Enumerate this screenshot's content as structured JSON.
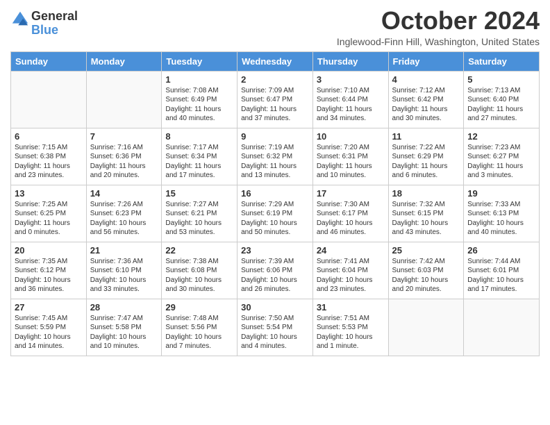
{
  "header": {
    "logo_general": "General",
    "logo_blue": "Blue",
    "title": "October 2024",
    "location": "Inglewood-Finn Hill, Washington, United States"
  },
  "days_of_week": [
    "Sunday",
    "Monday",
    "Tuesday",
    "Wednesday",
    "Thursday",
    "Friday",
    "Saturday"
  ],
  "weeks": [
    [
      {
        "day": "",
        "info": ""
      },
      {
        "day": "",
        "info": ""
      },
      {
        "day": "1",
        "info": "Sunrise: 7:08 AM\nSunset: 6:49 PM\nDaylight: 11 hours and 40 minutes."
      },
      {
        "day": "2",
        "info": "Sunrise: 7:09 AM\nSunset: 6:47 PM\nDaylight: 11 hours and 37 minutes."
      },
      {
        "day": "3",
        "info": "Sunrise: 7:10 AM\nSunset: 6:44 PM\nDaylight: 11 hours and 34 minutes."
      },
      {
        "day": "4",
        "info": "Sunrise: 7:12 AM\nSunset: 6:42 PM\nDaylight: 11 hours and 30 minutes."
      },
      {
        "day": "5",
        "info": "Sunrise: 7:13 AM\nSunset: 6:40 PM\nDaylight: 11 hours and 27 minutes."
      }
    ],
    [
      {
        "day": "6",
        "info": "Sunrise: 7:15 AM\nSunset: 6:38 PM\nDaylight: 11 hours and 23 minutes."
      },
      {
        "day": "7",
        "info": "Sunrise: 7:16 AM\nSunset: 6:36 PM\nDaylight: 11 hours and 20 minutes."
      },
      {
        "day": "8",
        "info": "Sunrise: 7:17 AM\nSunset: 6:34 PM\nDaylight: 11 hours and 17 minutes."
      },
      {
        "day": "9",
        "info": "Sunrise: 7:19 AM\nSunset: 6:32 PM\nDaylight: 11 hours and 13 minutes."
      },
      {
        "day": "10",
        "info": "Sunrise: 7:20 AM\nSunset: 6:31 PM\nDaylight: 11 hours and 10 minutes."
      },
      {
        "day": "11",
        "info": "Sunrise: 7:22 AM\nSunset: 6:29 PM\nDaylight: 11 hours and 6 minutes."
      },
      {
        "day": "12",
        "info": "Sunrise: 7:23 AM\nSunset: 6:27 PM\nDaylight: 11 hours and 3 minutes."
      }
    ],
    [
      {
        "day": "13",
        "info": "Sunrise: 7:25 AM\nSunset: 6:25 PM\nDaylight: 11 hours and 0 minutes."
      },
      {
        "day": "14",
        "info": "Sunrise: 7:26 AM\nSunset: 6:23 PM\nDaylight: 10 hours and 56 minutes."
      },
      {
        "day": "15",
        "info": "Sunrise: 7:27 AM\nSunset: 6:21 PM\nDaylight: 10 hours and 53 minutes."
      },
      {
        "day": "16",
        "info": "Sunrise: 7:29 AM\nSunset: 6:19 PM\nDaylight: 10 hours and 50 minutes."
      },
      {
        "day": "17",
        "info": "Sunrise: 7:30 AM\nSunset: 6:17 PM\nDaylight: 10 hours and 46 minutes."
      },
      {
        "day": "18",
        "info": "Sunrise: 7:32 AM\nSunset: 6:15 PM\nDaylight: 10 hours and 43 minutes."
      },
      {
        "day": "19",
        "info": "Sunrise: 7:33 AM\nSunset: 6:13 PM\nDaylight: 10 hours and 40 minutes."
      }
    ],
    [
      {
        "day": "20",
        "info": "Sunrise: 7:35 AM\nSunset: 6:12 PM\nDaylight: 10 hours and 36 minutes."
      },
      {
        "day": "21",
        "info": "Sunrise: 7:36 AM\nSunset: 6:10 PM\nDaylight: 10 hours and 33 minutes."
      },
      {
        "day": "22",
        "info": "Sunrise: 7:38 AM\nSunset: 6:08 PM\nDaylight: 10 hours and 30 minutes."
      },
      {
        "day": "23",
        "info": "Sunrise: 7:39 AM\nSunset: 6:06 PM\nDaylight: 10 hours and 26 minutes."
      },
      {
        "day": "24",
        "info": "Sunrise: 7:41 AM\nSunset: 6:04 PM\nDaylight: 10 hours and 23 minutes."
      },
      {
        "day": "25",
        "info": "Sunrise: 7:42 AM\nSunset: 6:03 PM\nDaylight: 10 hours and 20 minutes."
      },
      {
        "day": "26",
        "info": "Sunrise: 7:44 AM\nSunset: 6:01 PM\nDaylight: 10 hours and 17 minutes."
      }
    ],
    [
      {
        "day": "27",
        "info": "Sunrise: 7:45 AM\nSunset: 5:59 PM\nDaylight: 10 hours and 14 minutes."
      },
      {
        "day": "28",
        "info": "Sunrise: 7:47 AM\nSunset: 5:58 PM\nDaylight: 10 hours and 10 minutes."
      },
      {
        "day": "29",
        "info": "Sunrise: 7:48 AM\nSunset: 5:56 PM\nDaylight: 10 hours and 7 minutes."
      },
      {
        "day": "30",
        "info": "Sunrise: 7:50 AM\nSunset: 5:54 PM\nDaylight: 10 hours and 4 minutes."
      },
      {
        "day": "31",
        "info": "Sunrise: 7:51 AM\nSunset: 5:53 PM\nDaylight: 10 hours and 1 minute."
      },
      {
        "day": "",
        "info": ""
      },
      {
        "day": "",
        "info": ""
      }
    ]
  ]
}
